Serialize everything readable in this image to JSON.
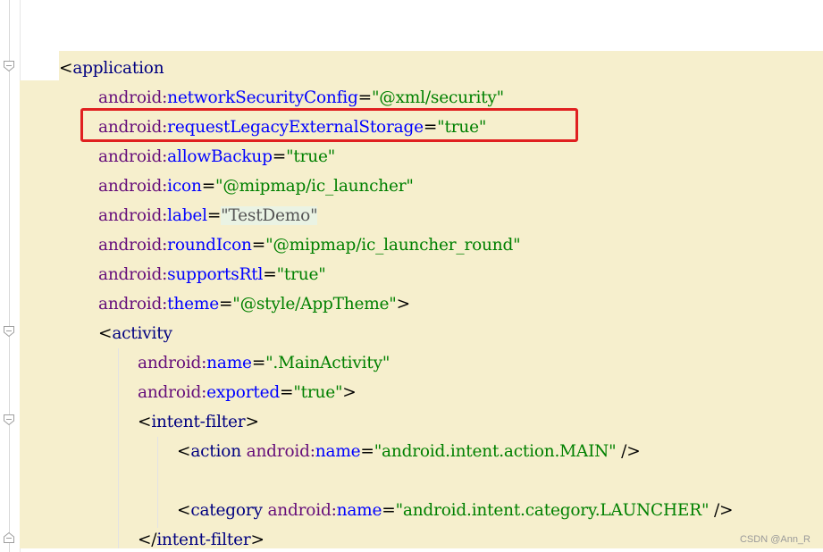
{
  "colors": {
    "background": "#f6efcd",
    "tag": "#000080",
    "namespace": "#660e7a",
    "attribute": "#0000ff",
    "value": "#008000",
    "highlight_box": "#e02020"
  },
  "code": {
    "line_application": {
      "open": "<",
      "tag": "application"
    },
    "line_network": {
      "ns": "android:",
      "attr": "networkSecurityConfig",
      "eq": "=",
      "value": "\"@xml/security\""
    },
    "line_legacy": {
      "ns": "android:",
      "attr": "requestLegacyExternalStorage",
      "eq": "=",
      "value": "\"true\""
    },
    "line_backup": {
      "ns": "android:",
      "attr": "allowBackup",
      "eq": "=",
      "value": "\"true\""
    },
    "line_icon": {
      "ns": "android:",
      "attr": "icon",
      "eq": "=",
      "value": "\"@mipmap/ic_launcher\""
    },
    "line_label": {
      "ns": "android:",
      "attr": "label",
      "eq": "=",
      "value": "\"TestDemo\""
    },
    "line_roundicon": {
      "ns": "android:",
      "attr": "roundIcon",
      "eq": "=",
      "value": "\"@mipmap/ic_launcher_round\""
    },
    "line_rtl": {
      "ns": "android:",
      "attr": "supportsRtl",
      "eq": "=",
      "value": "\"true\""
    },
    "line_theme": {
      "ns": "android:",
      "attr": "theme",
      "eq": "=",
      "value": "\"@style/AppTheme\"",
      "close": ">"
    },
    "line_activity": {
      "open": "<",
      "tag": "activity"
    },
    "line_name": {
      "ns": "android:",
      "attr": "name",
      "eq": "=",
      "value": "\".MainActivity\""
    },
    "line_exported": {
      "ns": "android:",
      "attr": "exported",
      "eq": "=",
      "value": "\"true\"",
      "close": ">"
    },
    "line_intent_open": {
      "open": "<",
      "tag": "intent-filter",
      "close": ">"
    },
    "line_action": {
      "open": "<",
      "tag": "action",
      "ns": "android:",
      "attr": "name",
      "eq": "=",
      "value": "\"android.intent.action.MAIN\"",
      "close": " />"
    },
    "line_category": {
      "open": "<",
      "tag": "category",
      "ns": "android:",
      "attr": "name",
      "eq": "=",
      "value": "\"android.intent.category.LAUNCHER\"",
      "close": " />"
    },
    "line_intent_close": {
      "open": "</",
      "tag": "intent-filter",
      "close": ">"
    }
  },
  "watermark": "CSDN @Ann_R"
}
